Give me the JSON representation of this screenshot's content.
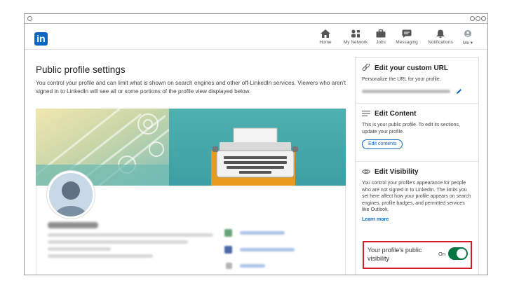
{
  "nav": {
    "logo": "in",
    "items": [
      {
        "label": "Home",
        "icon": "home-icon"
      },
      {
        "label": "My Network",
        "icon": "network-icon"
      },
      {
        "label": "Jobs",
        "icon": "briefcase-icon"
      },
      {
        "label": "Messaging",
        "icon": "chat-icon"
      },
      {
        "label": "Notifications",
        "icon": "bell-icon"
      },
      {
        "label": "Me ▾",
        "icon": "avatar-icon"
      }
    ]
  },
  "main": {
    "title": "Public profile settings",
    "description": "You control your profile and can limit what is shown on search engines and other off-LinkedIn services. Viewers who aren't signed in to LinkedIn will see all or some portions of the profile view displayed below."
  },
  "sidebar": {
    "custom_url": {
      "title": "Edit your custom URL",
      "text": "Personalize the URL for your profile.",
      "icon": "link-icon"
    },
    "edit_content": {
      "title": "Edit Content",
      "text": "This is your public profile. To edit its sections, update your profile.",
      "button": "Edit contents",
      "icon": "lines-icon"
    },
    "edit_visibility": {
      "title": "Edit Visibility",
      "text": "You control your profile's appearance for people who are not signed in to LinkedIn. The limits you set here affect how your profile appears on search engines, profile badges, and permitted services like Outlook.",
      "link": "Learn more",
      "icon": "eye-icon"
    },
    "public_visibility": {
      "label": "Your profile's public visibility",
      "state": "On"
    }
  },
  "colors": {
    "brand": "#0a66c2",
    "toggle_on": "#057642",
    "highlight": "#d31b27"
  }
}
